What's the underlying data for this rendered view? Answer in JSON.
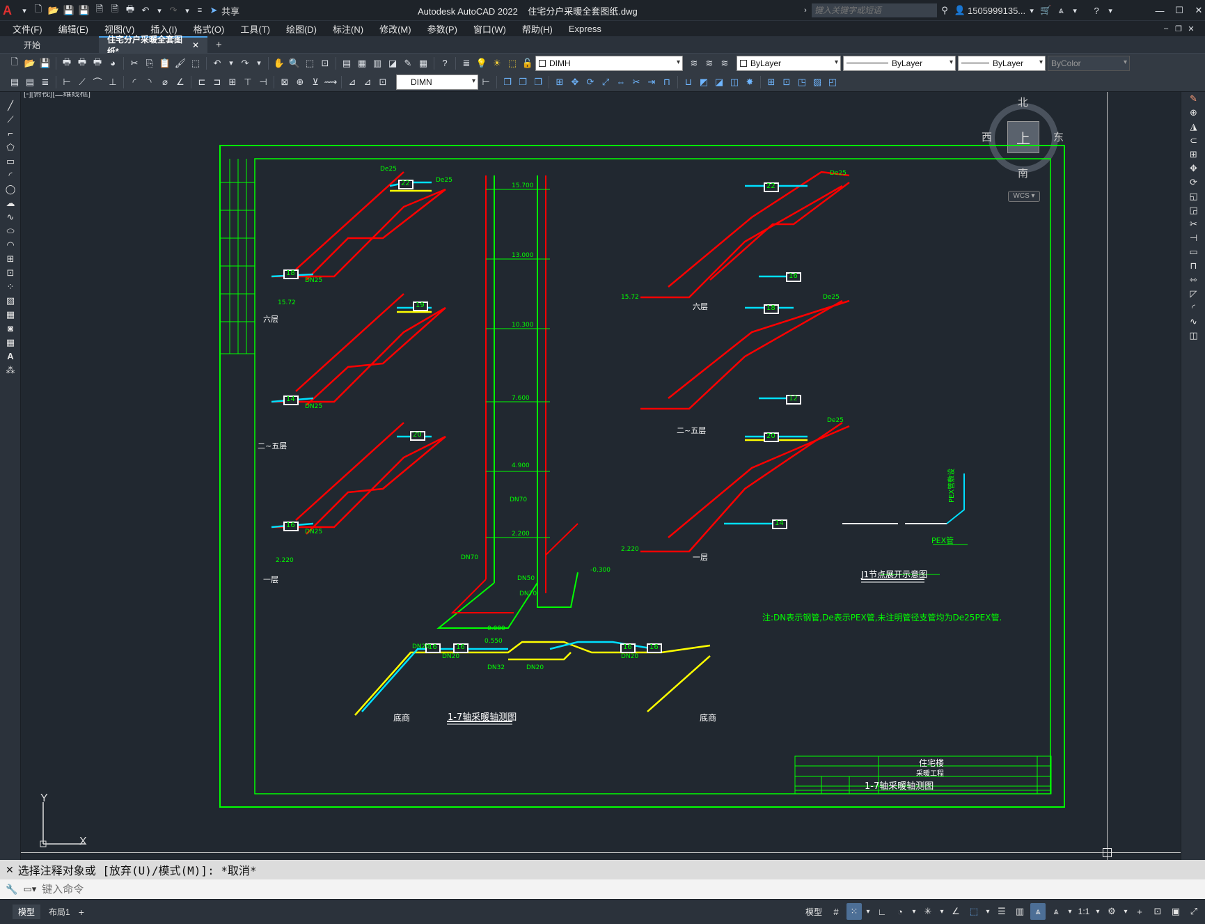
{
  "app": {
    "logo": "A",
    "title": "Autodesk AutoCAD 2022",
    "filename": "住宅分户采暖全套图纸.dwg",
    "share_label": "共享",
    "search_placeholder": "键入关键字或短语",
    "user": "1505999135...",
    "window_controls": [
      "—",
      "☐",
      "✕"
    ]
  },
  "menu": [
    "文件(F)",
    "编辑(E)",
    "视图(V)",
    "插入(I)",
    "格式(O)",
    "工具(T)",
    "绘图(D)",
    "标注(N)",
    "修改(M)",
    "参数(P)",
    "窗口(W)",
    "帮助(H)",
    "Express"
  ],
  "tabs": {
    "start": "开始",
    "active": "住宅分户采暖全套图纸*",
    "add": "+"
  },
  "toolbar": {
    "layer": "DIMH",
    "color": "ByLayer",
    "linetype": "ByLayer",
    "lineweight": "ByLayer",
    "plotstyle": "ByColor",
    "dimstyle": "DIMN"
  },
  "viewport": {
    "label": "[-][俯视][二维线框]",
    "compass": {
      "n": "北",
      "s": "南",
      "e": "东",
      "w": "西",
      "top": "上"
    },
    "wcs": "WCS",
    "ucs_x": "X",
    "ucs_y": "Y"
  },
  "drawing": {
    "left_floors": {
      "top": "六层",
      "middle": "二~五层",
      "bottom": "一层"
    },
    "right_floors": {
      "top": "六层",
      "middle": "二~五层",
      "bottom": "一层"
    },
    "left_radiators": [
      "22",
      "18",
      "19",
      "14",
      "20",
      "16"
    ],
    "right_radiators": [
      "22",
      "16",
      "18",
      "12",
      "20",
      "14"
    ],
    "bottom_radiators": [
      "16",
      "16",
      "16",
      "16"
    ],
    "riser_elevations": [
      "15.700",
      "13.000",
      "10.300",
      "7.600",
      "4.900",
      "2.200"
    ],
    "pipe_labels": {
      "de25": "De25",
      "dn25": "DN25",
      "dn70": "DN70",
      "dn40": "DN40",
      "dn50": "DN50",
      "dn20": "DN20",
      "dn32": "DN32"
    },
    "left_elevations": {
      "top": "15.72",
      "bottom": "2.220"
    },
    "right_elevations": {
      "top": "15.72",
      "bottom": "2.220"
    },
    "bottom_labels": {
      "left": "底商",
      "right": "底商",
      "axis_title": "1-7轴采暖轴测图",
      "elev_a": "0.000",
      "elev_b": "0.550",
      "elev_c": "-0.300"
    },
    "note": "注:DN表示钢管,De表示PEX管,未注明管径支管均为De25PEX管.",
    "detail": {
      "title": "J1节点展开示意图",
      "pex": "PEX管",
      "pex_vertical": "PEX管敷设"
    },
    "titleblock": {
      "project": "住宅楼",
      "system": "采暖工程",
      "drawing_title": "1-7轴采暖轴测图"
    }
  },
  "command": {
    "history": "选择注释对象或 [放弃(U)/模式(M)]: *取消*",
    "placeholder": "键入命令"
  },
  "status": {
    "model_tab": "模型",
    "layout_tab": "布局1",
    "add": "+",
    "model_btn": "模型",
    "scale": "1:1"
  }
}
